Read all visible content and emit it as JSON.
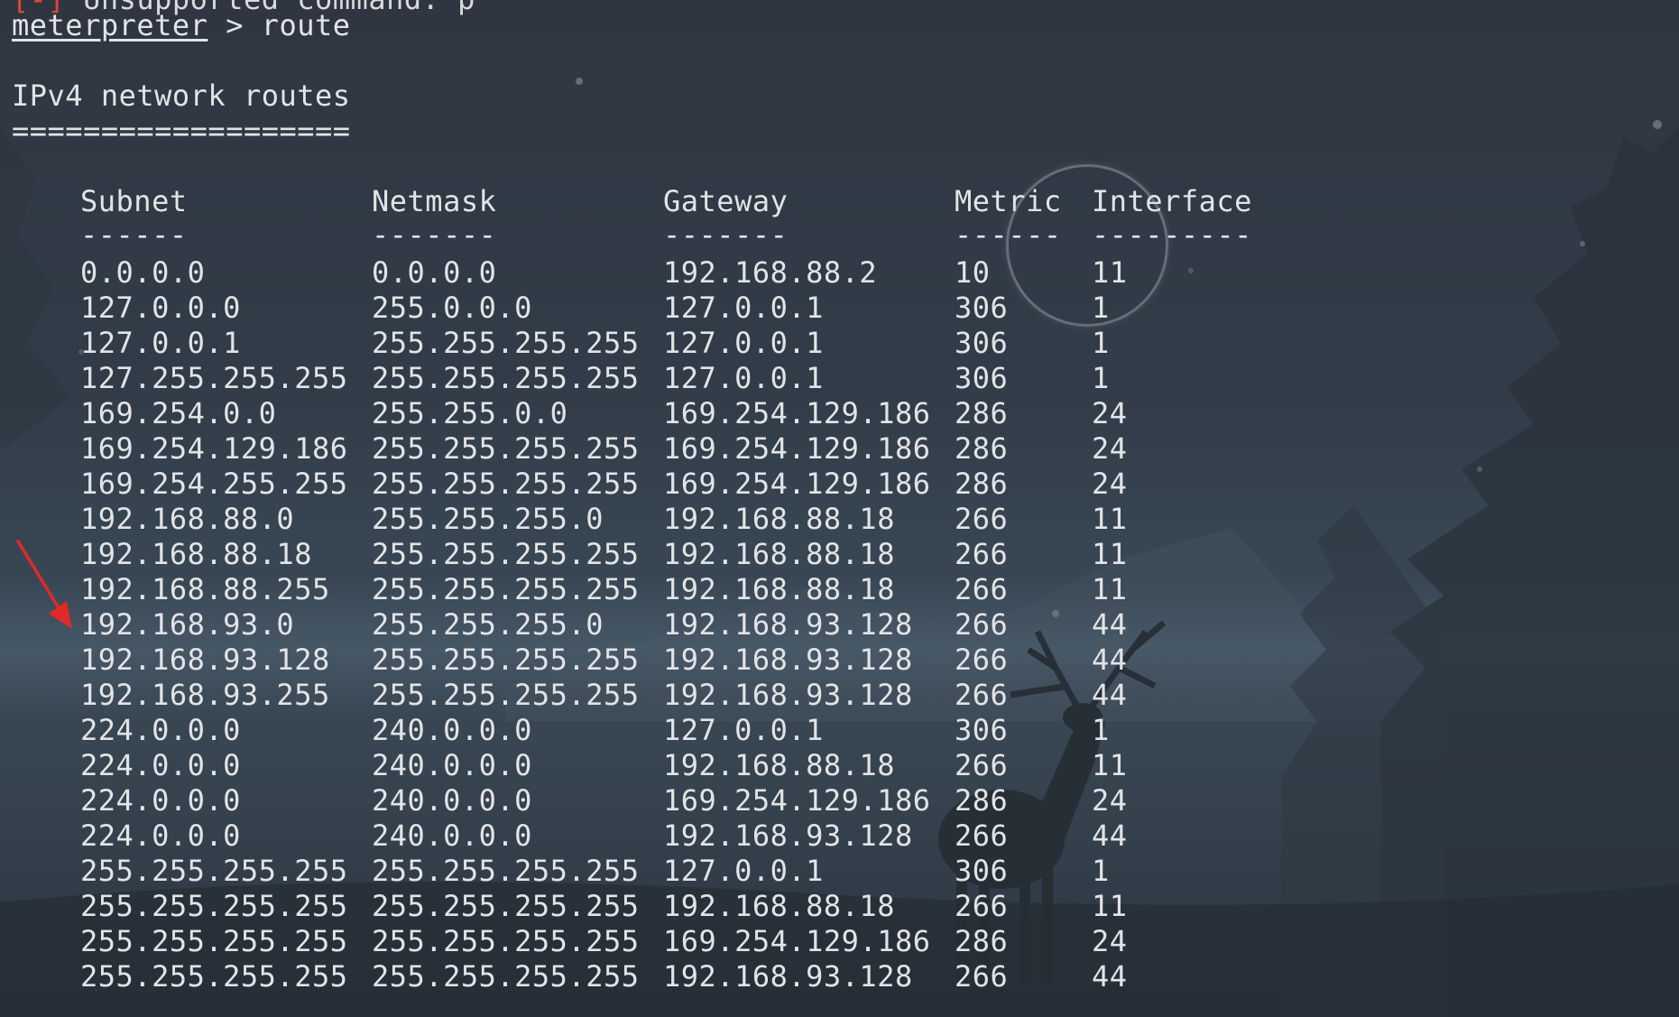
{
  "terminal": {
    "previous_line_marker": "[-]",
    "previous_line_text": " Unsupported command: p",
    "prompt": {
      "name": "meterpreter",
      "separator": " > ",
      "command": "route"
    },
    "section_title": "IPv4 network routes",
    "section_rule": "===================",
    "table": {
      "columns": [
        "Subnet",
        "Netmask",
        "Gateway",
        "Metric",
        "Interface"
      ],
      "separators": [
        "------",
        "-------",
        "-------",
        "------",
        "---------"
      ],
      "rows": [
        [
          "0.0.0.0",
          "0.0.0.0",
          "192.168.88.2",
          "10",
          "11"
        ],
        [
          "127.0.0.0",
          "255.0.0.0",
          "127.0.0.1",
          "306",
          "1"
        ],
        [
          "127.0.0.1",
          "255.255.255.255",
          "127.0.0.1",
          "306",
          "1"
        ],
        [
          "127.255.255.255",
          "255.255.255.255",
          "127.0.0.1",
          "306",
          "1"
        ],
        [
          "169.254.0.0",
          "255.255.0.0",
          "169.254.129.186",
          "286",
          "24"
        ],
        [
          "169.254.129.186",
          "255.255.255.255",
          "169.254.129.186",
          "286",
          "24"
        ],
        [
          "169.254.255.255",
          "255.255.255.255",
          "169.254.129.186",
          "286",
          "24"
        ],
        [
          "192.168.88.0",
          "255.255.255.0",
          "192.168.88.18",
          "266",
          "11"
        ],
        [
          "192.168.88.18",
          "255.255.255.255",
          "192.168.88.18",
          "266",
          "11"
        ],
        [
          "192.168.88.255",
          "255.255.255.255",
          "192.168.88.18",
          "266",
          "11"
        ],
        [
          "192.168.93.0",
          "255.255.255.0",
          "192.168.93.128",
          "266",
          "44"
        ],
        [
          "192.168.93.128",
          "255.255.255.255",
          "192.168.93.128",
          "266",
          "44"
        ],
        [
          "192.168.93.255",
          "255.255.255.255",
          "192.168.93.128",
          "266",
          "44"
        ],
        [
          "224.0.0.0",
          "240.0.0.0",
          "127.0.0.1",
          "306",
          "1"
        ],
        [
          "224.0.0.0",
          "240.0.0.0",
          "192.168.88.18",
          "266",
          "11"
        ],
        [
          "224.0.0.0",
          "240.0.0.0",
          "169.254.129.186",
          "286",
          "24"
        ],
        [
          "224.0.0.0",
          "240.0.0.0",
          "192.168.93.128",
          "266",
          "44"
        ],
        [
          "255.255.255.255",
          "255.255.255.255",
          "127.0.0.1",
          "306",
          "1"
        ],
        [
          "255.255.255.255",
          "255.255.255.255",
          "192.168.88.18",
          "266",
          "11"
        ],
        [
          "255.255.255.255",
          "255.255.255.255",
          "169.254.129.186",
          "286",
          "24"
        ],
        [
          "255.255.255.255",
          "255.255.255.255",
          "192.168.93.128",
          "266",
          "44"
        ]
      ]
    }
  },
  "annotations": {
    "arrow_color": "#e02a2a",
    "arrow_points_to_row": "192.168.93.0",
    "circle_marks": "Metric / Interface header area"
  },
  "theme": {
    "text_color": "#e2e4e6",
    "error_color": "#e2443a",
    "background_color": "#2f3641"
  }
}
